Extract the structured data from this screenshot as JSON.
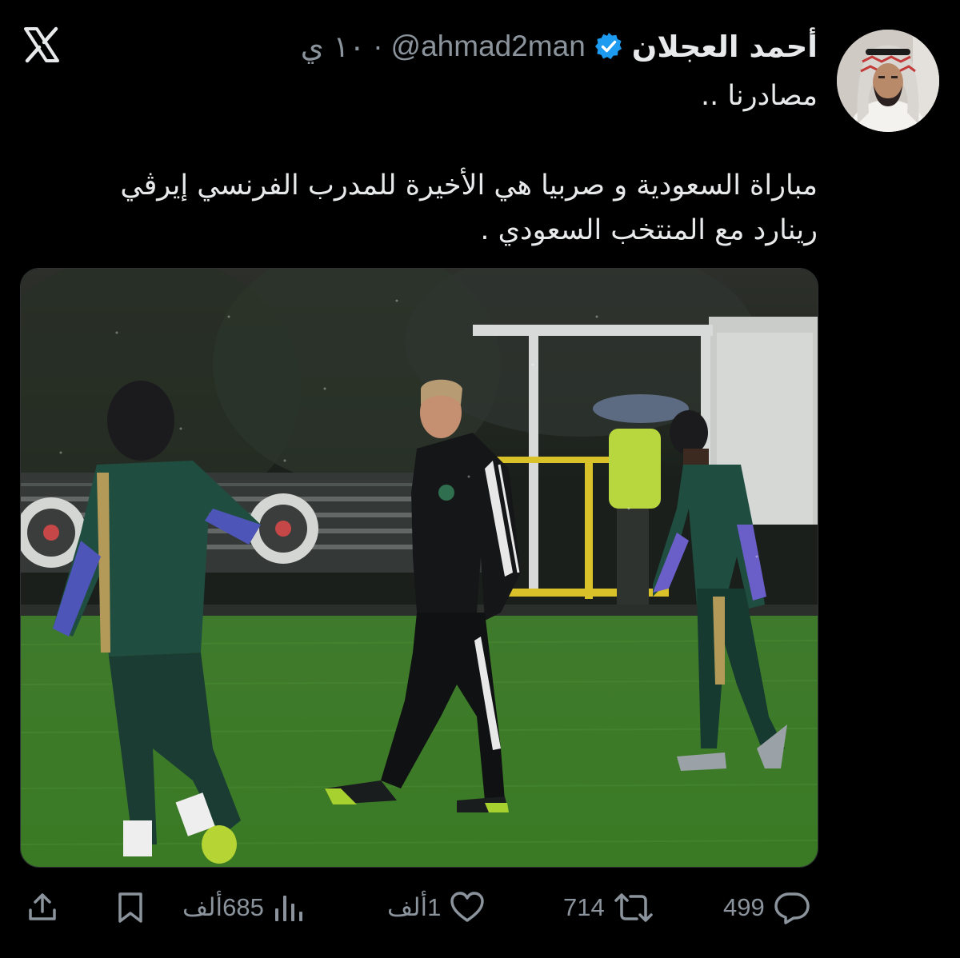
{
  "user": {
    "display_name": "أحمد العجلان",
    "handle": "@ahmad2man",
    "separator": "·",
    "time": "١٠ ي"
  },
  "tweet": {
    "line1": "مصادرنا ..",
    "line2": "مباراة السعودية و صربيا هي الأخيرة للمدرب الفرنسي إيرڤي",
    "line3": "رينارد مع المنتخب السعودي ."
  },
  "actions": {
    "replies": "499",
    "reposts": "714",
    "likes": "1ألف",
    "views": "685ألف"
  },
  "icons": {
    "logo": "x-logo-icon",
    "verified": "verified-badge-icon",
    "reply": "reply-icon",
    "repost": "repost-icon",
    "like": "heart-icon",
    "views": "views-chart-icon",
    "bookmark": "bookmark-icon",
    "share": "share-icon"
  },
  "colors": {
    "background": "#000000",
    "text": "#e7e9ea",
    "muted": "#8b949c",
    "verified": "#1d9bf0"
  }
}
